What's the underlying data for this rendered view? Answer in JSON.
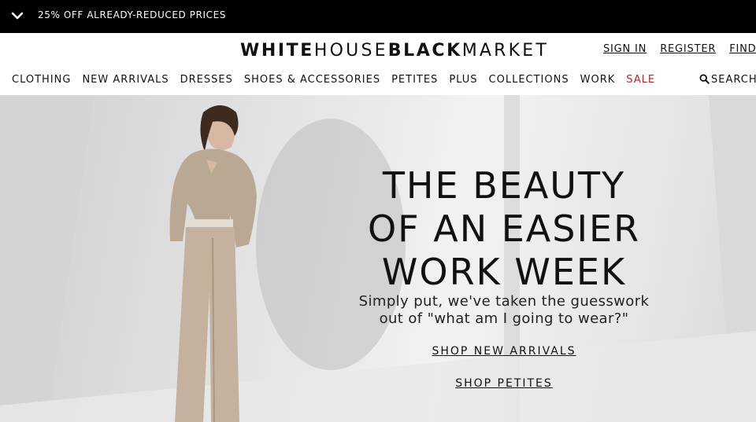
{
  "promo": {
    "text": "25% OFF ALREADY-REDUCED PRICES",
    "icon": "chevron-down-icon"
  },
  "logo": {
    "part1": "WHITE",
    "part2": "HOUSE",
    "part3": "BLACK",
    "part4": "MARKET"
  },
  "account": {
    "sign_in": "SIGN IN",
    "register": "REGISTER",
    "find": "FIND A"
  },
  "nav": {
    "items": [
      "CLOTHING",
      "NEW ARRIVALS",
      "DRESSES",
      "SHOES & ACCESSORIES",
      "PETITES",
      "PLUS",
      "COLLECTIONS",
      "WORK"
    ],
    "sale": "SALE",
    "sale_color": "#c41f1f"
  },
  "search": {
    "label": "SEARCH",
    "icon": "search-icon"
  },
  "hero": {
    "headline_1": "THE BEAUTY",
    "headline_2": "OF AN EASIER",
    "headline_3": "WORK WEEK",
    "sub_1": "Simply put, we've taken the guesswork",
    "sub_2": "out of \"what am I going to wear?\"",
    "cta_1": "SHOP NEW ARRIVALS",
    "cta_2": "SHOP PETITES"
  }
}
